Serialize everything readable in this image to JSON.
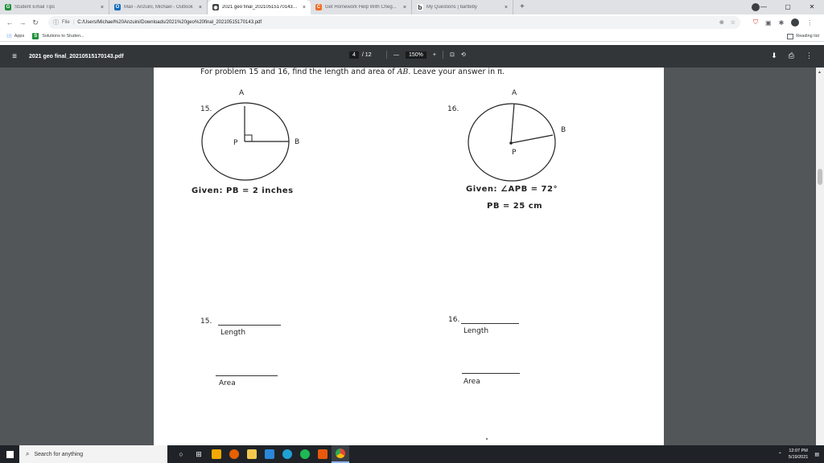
{
  "browser": {
    "tabs": [
      {
        "title": "Student Email Tips",
        "color": "#1f8f3a",
        "glyph": "G",
        "active": false,
        "close": "×"
      },
      {
        "title": "Mail - Anzuini, Michael - Outlook",
        "color": "#0f6cbd",
        "glyph": "O",
        "active": false,
        "close": "×"
      },
      {
        "title": "2021 geo final_202105151701431...",
        "color": "#3c4043",
        "glyph": "◉",
        "active": true,
        "close": "×"
      },
      {
        "title": "Get Homework Help With Cheg...",
        "color": "#f26b21",
        "glyph": "C",
        "active": false,
        "close": "×"
      },
      {
        "title": "My Questions | bartleby",
        "color": "#ffffff",
        "glyph": "b",
        "active": false,
        "close": "×"
      }
    ],
    "new_tab": "+",
    "window_controls": [
      "—",
      "▢",
      "✕"
    ],
    "address": {
      "info": "ⓘ",
      "scheme": "File",
      "url": "C:/Users/Michael%20Anzuini/Downloads/2021%20geo%20final_20210515170143.pdf"
    },
    "bookmarks": {
      "apps": "Apps",
      "item": "Solutions to Studen...",
      "reading_list": "Reading list"
    }
  },
  "pdf": {
    "title": "2021 geo final_20210515170143.pdf",
    "page_current": "4",
    "page_total": "/ 12",
    "zoom": "150%",
    "zoom_out": "—",
    "zoom_in": "+"
  },
  "document": {
    "instruction_pre": "For problem 15 and 16, find the length and area of ",
    "instruction_var": "AB",
    "instruction_post": ". Leave your answer in π.",
    "p15": {
      "num": "15.",
      "label_a": "A",
      "label_p": "P",
      "label_b": "B",
      "given": "Given: PB = 2 inches"
    },
    "p16": {
      "num": "16.",
      "label_a": "A",
      "label_p": "P",
      "label_b": "B",
      "given_line1": "Given: ∠APB = 72°",
      "given_line2": "PB = 25 cm"
    },
    "answers": {
      "num15": "15.",
      "num16": "16.",
      "length": "Length",
      "area": "Area"
    }
  },
  "taskbar": {
    "search_placeholder": "Search for anything",
    "time": "12:07 PM",
    "date": "5/19/2021",
    "app_icons": [
      {
        "name": "task-view-icon",
        "color": "#ffffff"
      },
      {
        "name": "widgets-icon",
        "color": "#ffffff"
      },
      {
        "name": "store-icon",
        "color": "#f2a900"
      },
      {
        "name": "firefox-icon",
        "color": "#e66000"
      },
      {
        "name": "file-explorer-icon",
        "color": "#f2c94c"
      },
      {
        "name": "mail-icon",
        "color": "#2b88d8"
      },
      {
        "name": "edge-icon",
        "color": "#1fa1d6"
      },
      {
        "name": "spotify-icon",
        "color": "#1db954"
      },
      {
        "name": "app-orange-icon",
        "color": "#e8590c"
      },
      {
        "name": "chrome-icon",
        "color": "#34a853"
      }
    ]
  }
}
